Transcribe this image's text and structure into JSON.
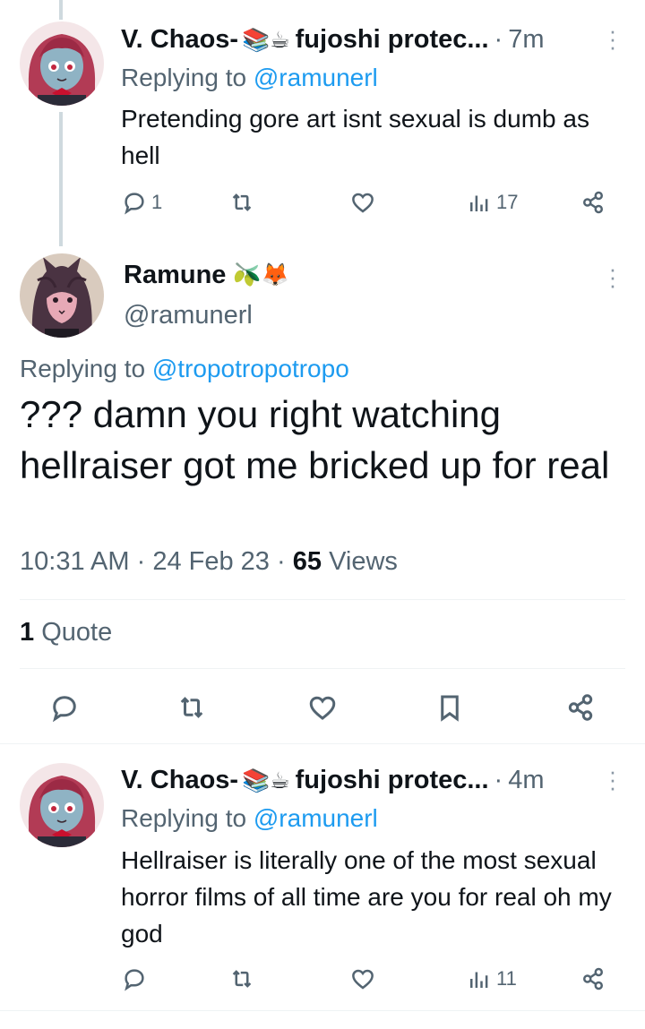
{
  "tweets": [
    {
      "author": "V. Chaos-",
      "emoji": "📚☕",
      "name_tail": "fujoshi protec...",
      "separator": "·",
      "time": "7m",
      "replying_prefix": "Replying to",
      "replying_handle": "@ramunerl",
      "text": "Pretending gore art isnt sexual is dumb as hell",
      "reply_count": "1",
      "retweet_count": "",
      "like_count": "",
      "views": "17"
    },
    {
      "author": "V. Chaos-",
      "emoji": "📚☕",
      "name_tail": "fujoshi protec...",
      "separator": "·",
      "time": "4m",
      "replying_prefix": "Replying to",
      "replying_handle": "@ramunerl",
      "text": "Hellraiser is literally one of the most sexual horror films of all time are you for real oh my god",
      "reply_count": "",
      "retweet_count": "",
      "like_count": "",
      "views": "11"
    }
  ],
  "main": {
    "author": "Ramune",
    "emoji": "🫒🦊",
    "handle": "@ramunerl",
    "replying_prefix": "Replying to",
    "replying_handle": "@tropotropotropo",
    "text": "??? damn you right watching hellraiser got me bricked up for real",
    "time": "10:31 AM",
    "date": "24 Feb 23",
    "sep": "·",
    "views_count": "65",
    "views_label": "Views",
    "quote_count": "1",
    "quote_label": "Quote"
  },
  "colors": {
    "link": "#1d9bf0",
    "muted": "#536471",
    "text": "#0f1419",
    "thread_line": "#cfd9de"
  },
  "icons": [
    "reply-icon",
    "retweet-icon",
    "like-icon",
    "views-icon",
    "share-icon",
    "bookmark-icon",
    "more-icon"
  ]
}
